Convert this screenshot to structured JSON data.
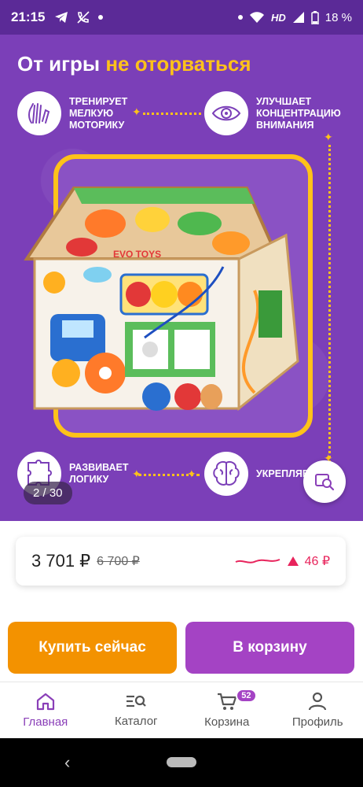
{
  "status_bar": {
    "time": "21:15",
    "network": "HD",
    "battery": "18 %",
    "icons": [
      "telegram-icon",
      "phone-off-icon",
      "dot-icon",
      "wifi-icon",
      "signal-icon",
      "battery-icon"
    ]
  },
  "hero": {
    "title_main": "От игры ",
    "title_accent": "не оторваться",
    "features": [
      {
        "text": "ТРЕНИРУЕТ МЕЛКУЮ МОТОРИКУ",
        "icon": "hands-icon"
      },
      {
        "text": "УЛУЧШАЕТ КОНЦЕНТРАЦИЮ ВНИМАНИЯ",
        "icon": "eye-icon"
      },
      {
        "text": "РАЗВИВАЕТ ЛОГИКУ",
        "icon": "puzzle-icon"
      },
      {
        "text": "УКРЕПЛЯЕТ ПАМЯТЬ",
        "icon": "brain-icon"
      }
    ],
    "image_brand": "EVO TOYS",
    "counter": "2 / 30"
  },
  "price": {
    "current": "3 701 ₽",
    "old": "6 700 ₽",
    "delta": "46 ₽",
    "accent": "#e8245c"
  },
  "actions": {
    "buy_now": "Купить сейчас",
    "add_to_cart": "В корзину"
  },
  "nav": {
    "items": [
      {
        "label": "Главная",
        "icon": "home-icon",
        "active": true
      },
      {
        "label": "Каталог",
        "icon": "catalog-search-icon",
        "active": false
      },
      {
        "label": "Корзина",
        "icon": "cart-icon",
        "active": false,
        "badge": "52"
      },
      {
        "label": "Профиль",
        "icon": "profile-icon",
        "active": false
      }
    ]
  },
  "colors": {
    "brand_purple": "#7b3fb8",
    "accent_yellow": "#ffc21a",
    "buy_orange": "#f39200",
    "cart_purple": "#a443c4"
  }
}
